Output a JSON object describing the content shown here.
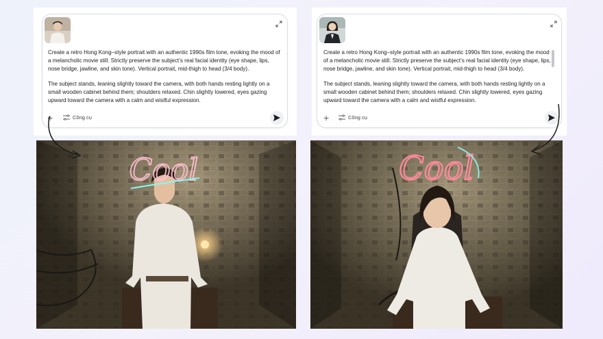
{
  "left": {
    "prompt_p1": "Create a retro Hong Kong–style portrait with an authentic 1990s film tone, evoking the mood of a melancholic movie still. Strictly preserve the subject’s real facial identity (eye shape, lips, nose bridge, jawline, and skin tone). Vertical portrait, mid-thigh to head (3/4 body).",
    "prompt_p2": "The subject stands, leaning slightly toward the camera, with both hands resting lightly on a small wooden cabinet behind them; shoulders relaxed. Chin slightly lowered, eyes gazing upward toward the camera with a calm and wistful expression.",
    "tools_label": "Công cụ",
    "plus_label": "+",
    "neon_text": "Cool"
  },
  "right": {
    "prompt_p1": "Create a retro Hong Kong–style portrait with an authentic 1990s film tone, evoking the mood of a melancholic movie still. Strictly preserve the subject’s real facial identity (eye shape, lips, nose bridge, jawline, and skin tone). Vertical portrait, mid-thigh to head (3/4 body).",
    "prompt_p2": "The subject stands, leaning slightly toward the camera, with both hands resting lightly on a small wooden cabinet behind them; shoulders relaxed. Chin slightly lowered, eyes gazing upward toward the camera with a calm and wistful expression.",
    "tools_label": "Công cụ",
    "plus_label": "+",
    "neon_text": "Cool"
  },
  "icons": {
    "expand": "expand-icon",
    "tools": "tune-icon",
    "send": "send-icon",
    "add": "plus-icon"
  },
  "colors": {
    "neon_pink": "#ff6a8a",
    "neon_cyan": "#7ff7f0",
    "wall_tone": "#8b7a5e"
  }
}
